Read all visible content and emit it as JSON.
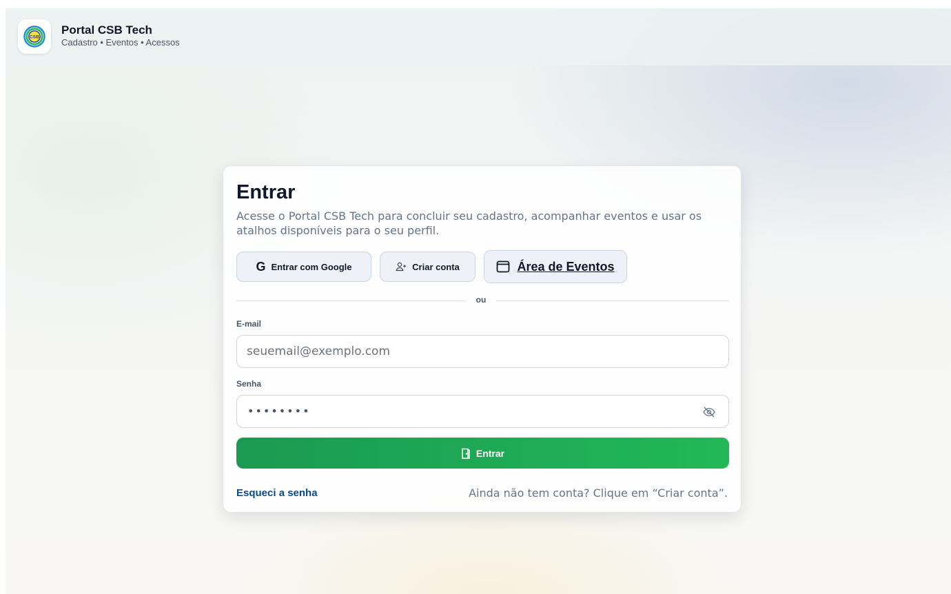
{
  "header": {
    "title": "Portal CSB Tech",
    "subtitle": "Cadastro • Eventos • Acessos",
    "logo_text": "CSB"
  },
  "login": {
    "title": "Entrar",
    "description": "Acesse o Portal CSB Tech para concluir seu cadastro, acompanhar eventos e usar os atalhos disponíveis para o seu perfil.",
    "google_button": "Entrar com Google",
    "google_icon": "G",
    "create_account_button": "Criar conta",
    "events_button": "Área de Eventos",
    "divider": "ou",
    "email_label": "E-mail",
    "email_placeholder": "seuemail@exemplo.com",
    "password_label": "Senha",
    "password_mask": "••••••••",
    "submit_button": "Entrar",
    "forgot_link": "Esqueci a senha",
    "signup_hint": "Ainda não tem conta? Clique em “Criar conta”."
  },
  "colors": {
    "primary_green": "#22b857",
    "link_blue": "#0b4a8b",
    "text_dark": "#0f172a",
    "text_muted": "#64748b"
  },
  "icons": {
    "logo": "csb-logo-icon",
    "google": "google-icon",
    "create_account": "user-plus-icon",
    "events": "calendar-icon",
    "password_toggle": "eye-off-icon",
    "submit": "door-icon"
  }
}
